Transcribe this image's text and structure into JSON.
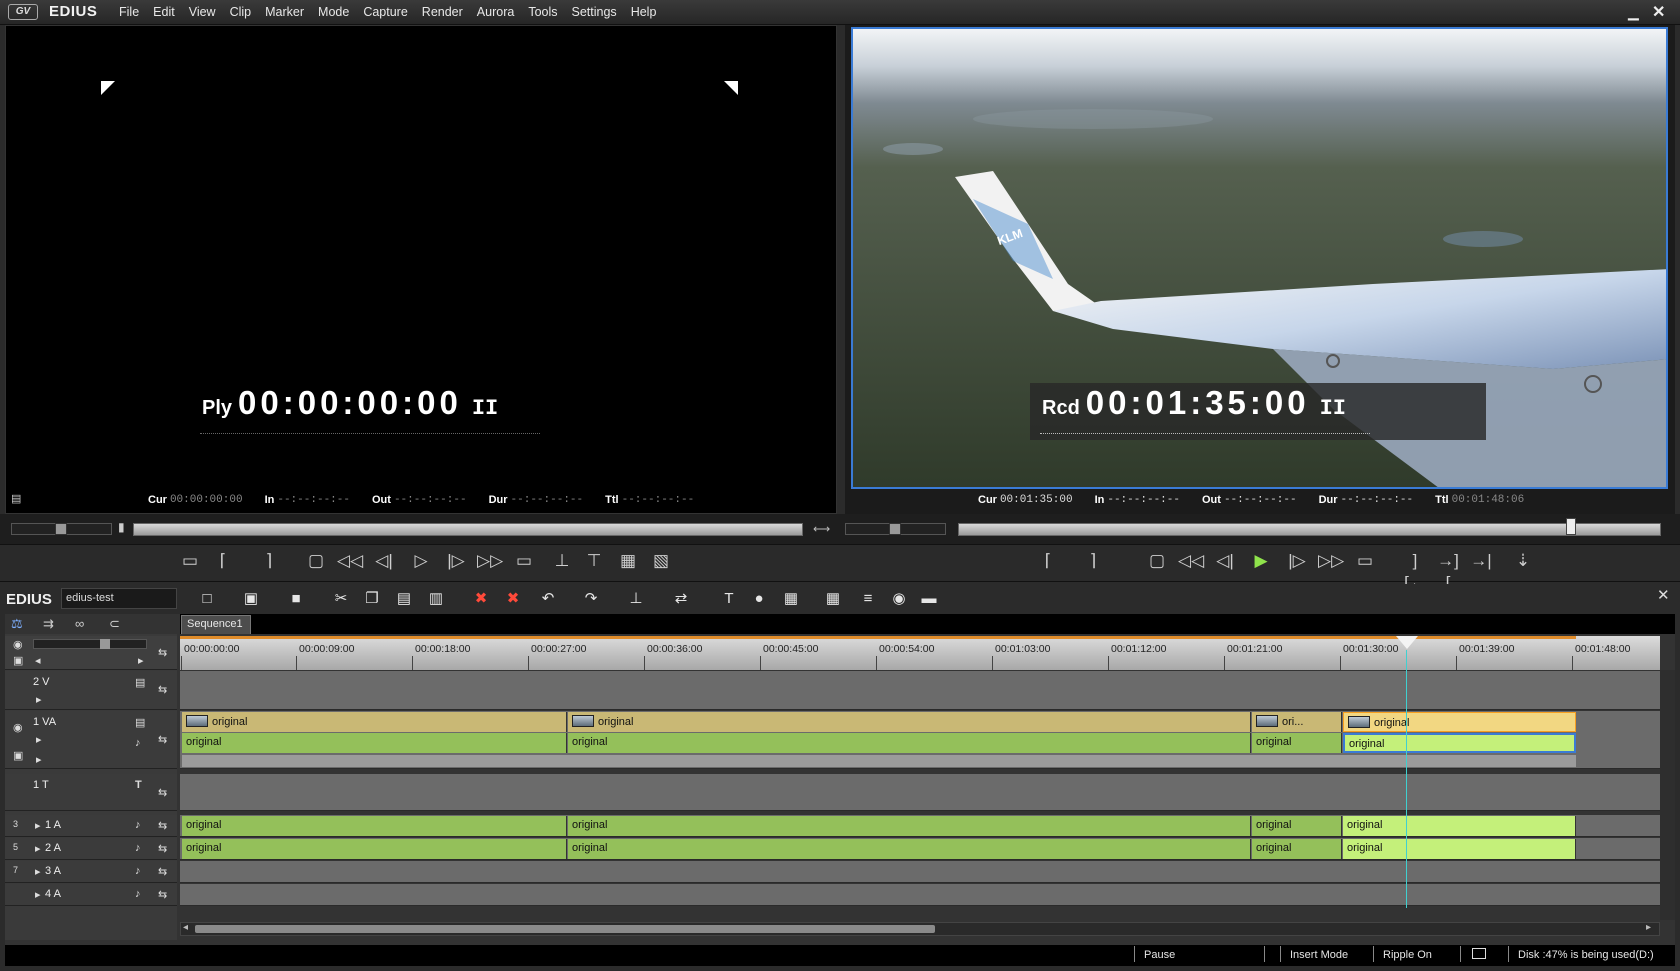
{
  "app": {
    "name": "EDIUS",
    "menus": [
      "File",
      "Edit",
      "View",
      "Clip",
      "Marker",
      "Mode",
      "Capture",
      "Render",
      "Aurora",
      "Tools",
      "Settings",
      "Help"
    ]
  },
  "player": {
    "prefix": "Ply",
    "timecode": "00:00:00:00",
    "pause_icon": "II",
    "info": [
      {
        "label": "Cur",
        "value": "00:00:00:00"
      },
      {
        "label": "In",
        "value": "--:--:--:--"
      },
      {
        "label": "Out",
        "value": "--:--:--:--"
      },
      {
        "label": "Dur",
        "value": "--:--:--:--"
      },
      {
        "label": "Ttl",
        "value": "--:--:--:--"
      }
    ]
  },
  "recorder": {
    "prefix": "Rcd",
    "timecode": "00:01:35:00",
    "pause_icon": "II",
    "wing_logo": "KLM",
    "info": [
      {
        "label": "Cur",
        "value": "00:01:35:00"
      },
      {
        "label": "In",
        "value": "--:--:--:--"
      },
      {
        "label": "Out",
        "value": "--:--:--:--"
      },
      {
        "label": "Dur",
        "value": "--:--:--:--"
      },
      {
        "label": "Ttl",
        "value": "00:01:48:06"
      }
    ]
  },
  "timeline": {
    "brand": "EDIUS",
    "project": "edius-test",
    "sequence_tab": "Sequence1",
    "ruler": [
      "00:00:00:00",
      "00:00:09:00",
      "00:00:18:00",
      "00:00:27:00",
      "00:00:36:00",
      "00:00:45:00",
      "00:00:54:00",
      "00:01:03:00",
      "00:01:12:00",
      "00:01:21:00",
      "00:01:30:00",
      "00:01:39:00",
      "00:01:48:00"
    ],
    "tracks": [
      {
        "name": "2 V"
      },
      {
        "name": "1 VA"
      },
      {
        "name": "1 T"
      },
      {
        "name": "1 A",
        "ch": "3"
      },
      {
        "name": "2 A",
        "ch": "5"
      },
      {
        "name": "3 A",
        "ch": "7"
      },
      {
        "name": "4 A"
      }
    ],
    "clip_label": "original",
    "clip_short": "ori..."
  },
  "status": {
    "state": "Pause",
    "mode": "Insert Mode",
    "ripple": "Ripple On",
    "disk": "Disk :47% is being used(D:)"
  },
  "colors": {
    "accent_blue": "#3a7bd5",
    "video_clip": "#c9b875",
    "audio_clip": "#94c05a",
    "selected_clip_border": "#f8a020",
    "play_active": "#8fe34b",
    "timeline_cursor": "#40d0d0"
  }
}
